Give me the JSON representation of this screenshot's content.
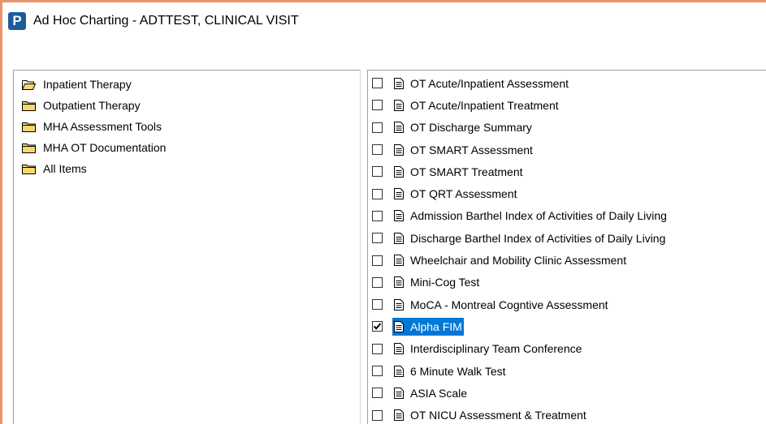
{
  "window": {
    "icon_letter": "P",
    "title": "Ad Hoc Charting - ADTTEST, CLINICAL VISIT"
  },
  "folders": [
    {
      "label": "Inpatient Therapy",
      "icon": "folder-open-icon",
      "open": true
    },
    {
      "label": "Outpatient Therapy",
      "icon": "folder-icon",
      "open": false
    },
    {
      "label": "MHA Assessment Tools",
      "icon": "folder-icon",
      "open": false
    },
    {
      "label": "MHA OT Documentation",
      "icon": "folder-icon",
      "open": false
    },
    {
      "label": "All Items",
      "icon": "folder-icon",
      "open": false
    }
  ],
  "documents": [
    {
      "label": "OT Acute/Inpatient Assessment",
      "checked": false,
      "selected": false
    },
    {
      "label": "OT Acute/Inpatient Treatment",
      "checked": false,
      "selected": false
    },
    {
      "label": "OT Discharge Summary",
      "checked": false,
      "selected": false
    },
    {
      "label": "OT SMART Assessment",
      "checked": false,
      "selected": false
    },
    {
      "label": "OT SMART Treatment",
      "checked": false,
      "selected": false
    },
    {
      "label": "OT QRT Assessment",
      "checked": false,
      "selected": false
    },
    {
      "label": "Admission Barthel Index of Activities of Daily Living",
      "checked": false,
      "selected": false
    },
    {
      "label": "Discharge Barthel Index of Activities of Daily Living",
      "checked": false,
      "selected": false
    },
    {
      "label": "Wheelchair and Mobility Clinic Assessment",
      "checked": false,
      "selected": false
    },
    {
      "label": "Mini-Cog Test",
      "checked": false,
      "selected": false
    },
    {
      "label": "MoCA - Montreal Cogntive Assessment",
      "checked": false,
      "selected": false
    },
    {
      "label": "Alpha FIM",
      "checked": true,
      "selected": true
    },
    {
      "label": "Interdisciplinary Team Conference",
      "checked": false,
      "selected": false
    },
    {
      "label": "6 Minute Walk Test",
      "checked": false,
      "selected": false
    },
    {
      "label": "ASIA Scale",
      "checked": false,
      "selected": false
    },
    {
      "label": "OT NICU Assessment & Treatment",
      "checked": false,
      "selected": false
    }
  ],
  "colors": {
    "accent_border": "#e8956a",
    "selection": "#0078d7",
    "app_icon": "#1d5c9a"
  }
}
